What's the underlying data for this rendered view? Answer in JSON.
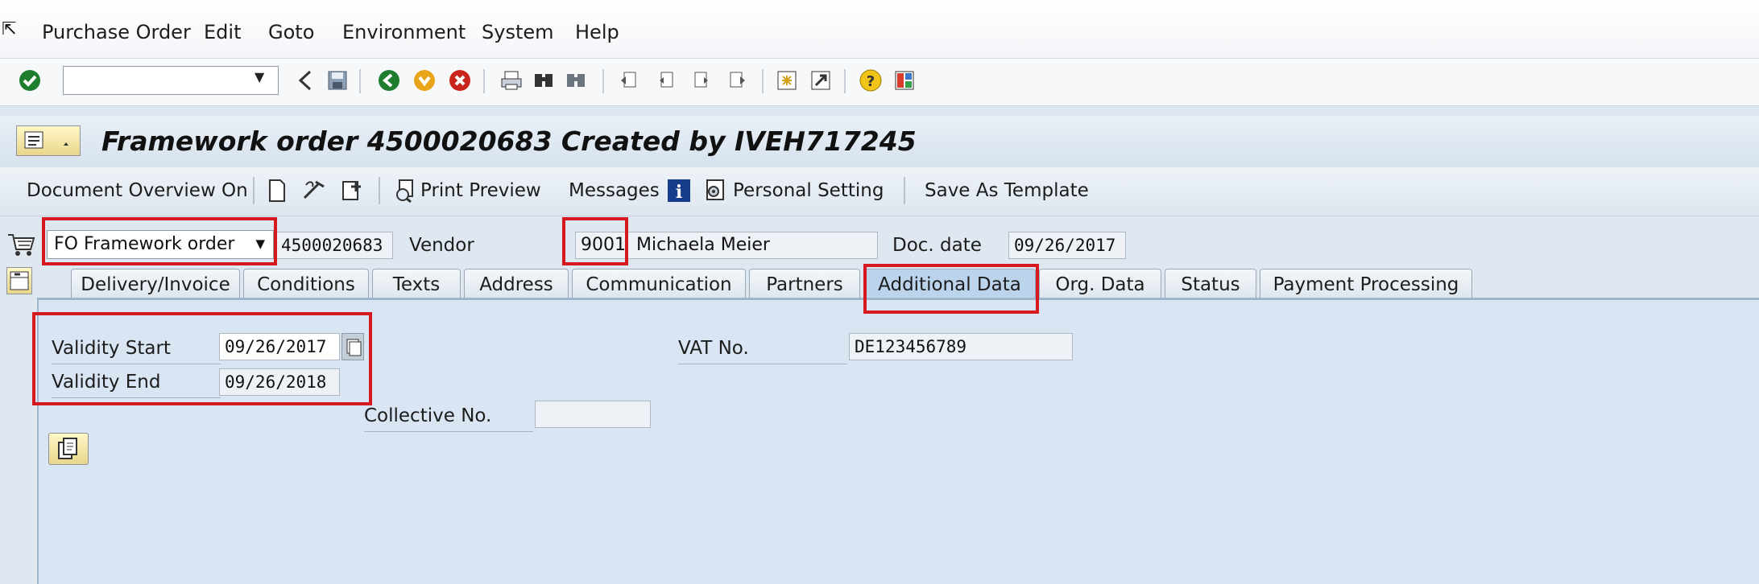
{
  "menu": {
    "purchase_order": "Purchase Order",
    "edit": "Edit",
    "goto": "Goto",
    "environment": "Environment",
    "system": "System",
    "help": "Help"
  },
  "title": "Framework order 4500020683 Created by IVEH717245",
  "app_toolbar": {
    "document_overview": "Document Overview On",
    "print_preview": "Print Preview",
    "messages": "Messages",
    "personal_setting": "Personal Setting",
    "save_as_template": "Save As Template"
  },
  "header": {
    "order_type": "FO Framework order",
    "po_number": "4500020683",
    "vendor_label": "Vendor",
    "vendor_number": "9001",
    "vendor_name": "Michaela Meier",
    "doc_date_label": "Doc. date",
    "doc_date": "09/26/2017"
  },
  "tabs": [
    {
      "label": "Delivery/Invoice"
    },
    {
      "label": "Conditions"
    },
    {
      "label": "Texts"
    },
    {
      "label": "Address"
    },
    {
      "label": "Communication"
    },
    {
      "label": "Partners"
    },
    {
      "label": "Additional Data"
    },
    {
      "label": "Org. Data"
    },
    {
      "label": "Status"
    },
    {
      "label": "Payment Processing"
    }
  ],
  "additional_data": {
    "validity_start_label": "Validity Start",
    "validity_start": "09/26/2017",
    "validity_end_label": "Validity End",
    "validity_end": "09/26/2018",
    "collective_no_label": "Collective No.",
    "collective_no": "",
    "vat_no_label": "VAT No.",
    "vat_no": "DE123456789"
  },
  "colors": {
    "highlight": "#d6191e",
    "active_tab": "#bcd3ec",
    "panel": "#d9e5f2"
  }
}
